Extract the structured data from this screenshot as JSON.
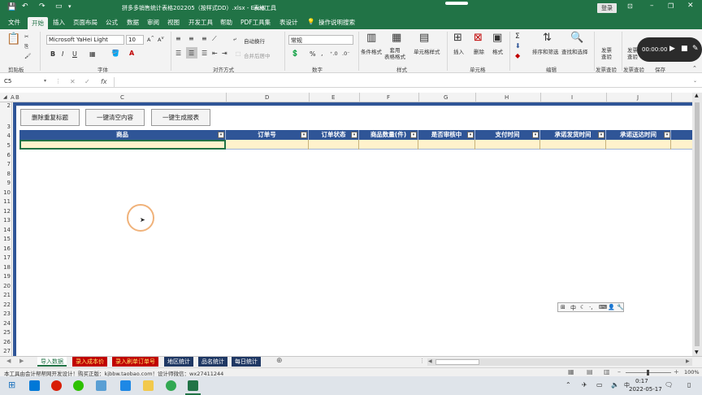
{
  "titlebar": {
    "doc_title": "拼多多销售统计表格202205（按样式DD）.xlsx - Excel",
    "context_tab": "表格工具",
    "login": "登录"
  },
  "menu": {
    "tabs": [
      "文件",
      "开始",
      "插入",
      "页面布局",
      "公式",
      "数据",
      "审阅",
      "视图",
      "开发工具",
      "帮助",
      "PDF工具集",
      "表设计"
    ],
    "tell_me": "操作说明搜索"
  },
  "ribbon": {
    "clipboard_group": "剪贴板",
    "font_name": "Microsoft YaHei Light",
    "font_size": "10",
    "font_group": "字体",
    "wrap_text": "自动换行",
    "merge_center": "合并后居中",
    "alignment_group": "对齐方式",
    "number_format": "常规",
    "number_group": "数字",
    "cond_format": "条件格式",
    "table_format": "套用\n表格格式",
    "cell_styles": "单元格样式",
    "styles_group": "样式",
    "insert": "插入",
    "delete": "删除",
    "format": "格式",
    "cells_group": "单元格",
    "sort_filter": "排序和筛选",
    "find_select": "查找和选择",
    "editing_group": "编辑",
    "invoice_check": "发票\n查验",
    "invoice_check2": "发票\n查验",
    "invoice_group": "发票查验",
    "save_group": "保存"
  },
  "recorder": {
    "time": "00:00:00"
  },
  "formula": {
    "name_box": "C5",
    "fx": "fx",
    "value": ""
  },
  "columns": [
    "A",
    "B",
    "C",
    "D",
    "E",
    "F",
    "G",
    "H",
    "I",
    "J"
  ],
  "rows": [
    "2",
    "3",
    "4",
    "5",
    "6",
    "7",
    "8",
    "9",
    "10",
    "11",
    "12",
    "13",
    "14",
    "15",
    "16",
    "17",
    "18",
    "19",
    "20",
    "21",
    "22",
    "23",
    "24",
    "25",
    "26",
    "27"
  ],
  "buttons": {
    "remove_dup": "删除重复标题",
    "clear_all": "一键清空内容",
    "gen_report": "一键生成报表"
  },
  "table": {
    "headers": [
      "商品",
      "订单号",
      "订单状态",
      "商品数量(件)",
      "是否审核中",
      "支付时间",
      "承诺发货时间",
      "承诺送达时间"
    ]
  },
  "sheets": [
    "导入数据",
    "录入成本价",
    "录入刷单订单号",
    "地区统计",
    "品名统计",
    "每日统计"
  ],
  "status": {
    "message": "本工具由会计帮帮网开发设计！购买正版：kjbbw.taobao.com！设计师微信：wx27411244",
    "zoom": "100%"
  },
  "taskbar": {
    "time": "0:17",
    "date": "2022-05-17",
    "ime": "中"
  },
  "colors": {
    "excel_green": "#217346",
    "header_blue": "#2f5597",
    "data_yellow": "#fff2cc",
    "sheet_tab_red": "#c00000",
    "sheet_tab_navy": "#1f3864"
  }
}
